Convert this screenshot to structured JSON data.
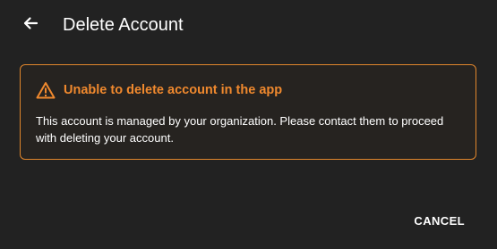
{
  "header": {
    "back_icon": "arrow-left-icon",
    "title": "Delete Account"
  },
  "alert": {
    "icon": "warning-triangle-icon",
    "title": "Unable to delete account in the app",
    "message": "This account is managed by your organization. Please contact them to proceed with deleting your account.",
    "border_color": "#e0862c",
    "accent_color": "#f0892e"
  },
  "actions": {
    "cancel_label": "CANCEL"
  },
  "colors": {
    "background": "#222222",
    "text": "#ffffff"
  }
}
